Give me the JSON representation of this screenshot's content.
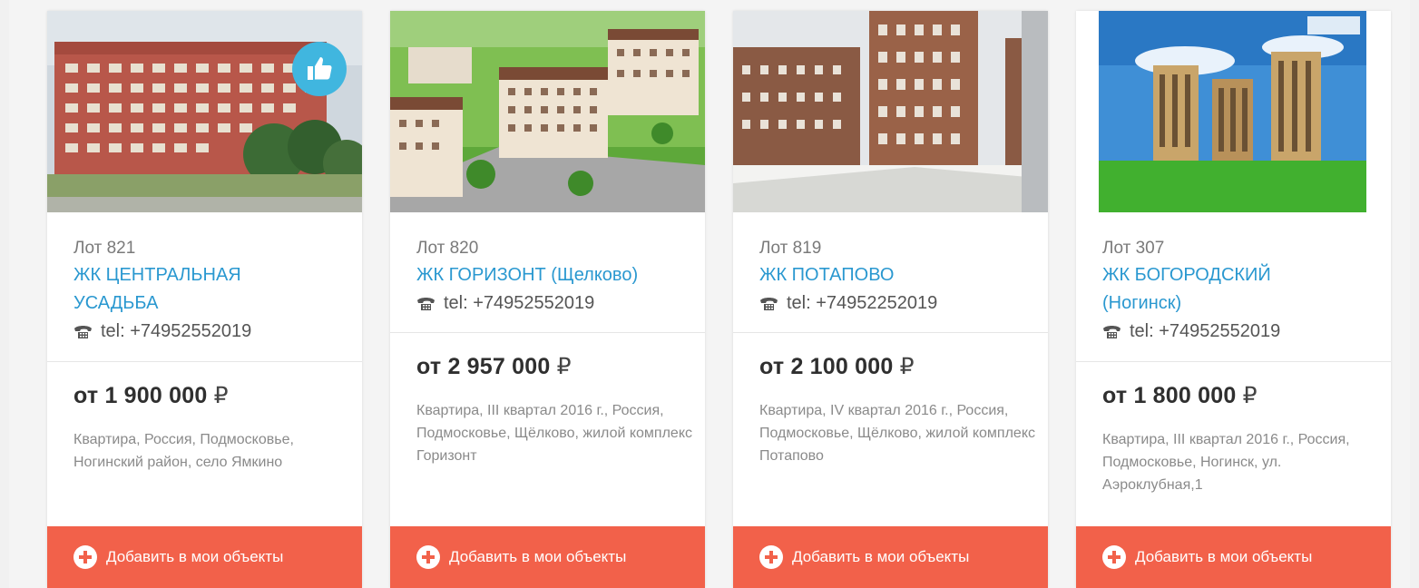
{
  "cards": [
    {
      "lot": "Лот 821",
      "title": "ЖК ЦЕНТРАЛЬНАЯ УСАДЬБА",
      "phone": "tel: +74952552019",
      "price": "от 1 900 000",
      "currency": "₽",
      "description": "Квартира, Россия, Подмосковье, Ногинский район, село Ямкино",
      "button": "Добавить в мои объекты",
      "badge_icon": "thumbs-up-icon"
    },
    {
      "lot": "Лот 820",
      "title": "ЖК ГОРИЗОНТ (Щелково)",
      "phone": "tel: +74952552019",
      "price": "от 2 957 000",
      "currency": "₽",
      "description": "Квартира, III квартал 2016 г., Россия, Подмосковье, Щёлково, жилой комплекс Горизонт",
      "button": "Добавить в мои объекты"
    },
    {
      "lot": "Лот 819",
      "title": "ЖК ПОТАПОВО",
      "phone": "tel: +74952252019",
      "price": "от 2 100 000",
      "currency": "₽",
      "description": "Квартира, IV квартал 2016 г., Россия, Подмосковье, Щёлково, жилой комплекс Потапово",
      "button": "Добавить в мои объекты"
    },
    {
      "lot": "Лот 307",
      "title": "ЖК БОГОРОДСКИЙ (Ногинск)",
      "phone": "tel: +74952552019",
      "price": "от 1 800 000",
      "currency": "₽",
      "description": "Квартира, III квартал 2016 г., Россия, Подмосковье, Ногинск, ул. Аэроклубная,1",
      "button": "Добавить в мои объекты"
    }
  ],
  "colors": {
    "accent": "#2a98d0",
    "button": "#f2614a",
    "badge": "#40b6df"
  },
  "icons": [
    "thumbs-up-icon",
    "phone-icon",
    "plus-circle-icon"
  ]
}
